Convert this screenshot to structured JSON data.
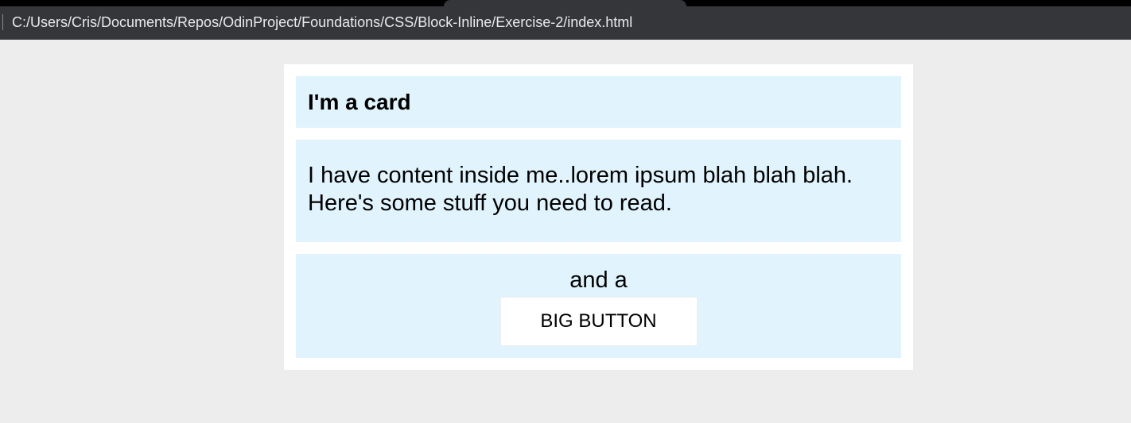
{
  "browser": {
    "address": "C:/Users/Cris/Documents/Repos/OdinProject/Foundations/CSS/Block-Inline/Exercise-2/index.html"
  },
  "card": {
    "header": "I'm a card",
    "body": "I have content inside me..lorem ipsum blah blah blah. Here's some stuff you need to read.",
    "footer_text": "and a",
    "button_label": "BIG BUTTON"
  },
  "colors": {
    "page_background": "#ededed",
    "card_background": "#ffffff",
    "section_background": "#e1f3fc",
    "browser_chrome": "#35363a"
  }
}
